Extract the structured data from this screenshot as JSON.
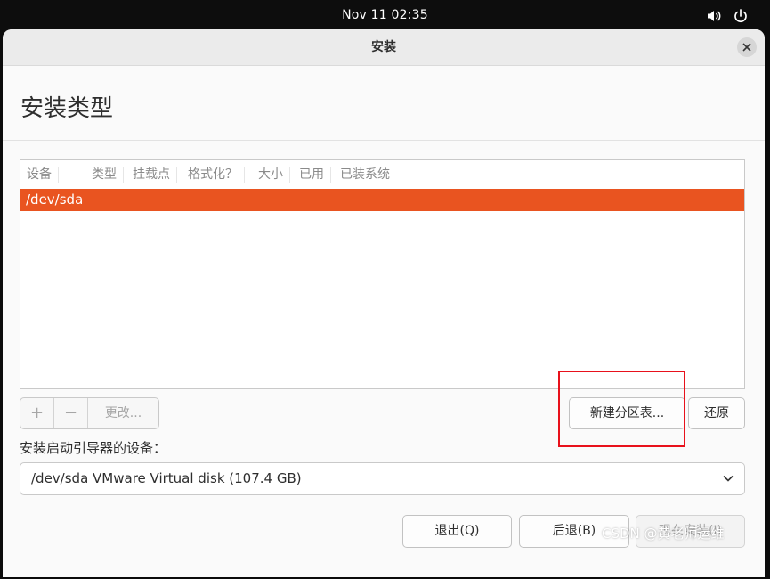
{
  "topbar": {
    "clock": "Nov 11  02:35",
    "icons": [
      "volume-icon",
      "power-icon"
    ]
  },
  "window": {
    "title": "安装",
    "close_icon": "close-icon"
  },
  "page": {
    "title": "安装类型"
  },
  "partition_table": {
    "columns": [
      "设备",
      "类型",
      "挂载点",
      "格式化？",
      "大小",
      "已用",
      "已装系统"
    ],
    "rows": [
      {
        "device": "/dev/sda",
        "selected": true
      }
    ]
  },
  "toolbar": {
    "add_label": "+",
    "remove_label": "−",
    "change_label": "更改..."
  },
  "actions": {
    "new_table_label": "新建分区表...",
    "revert_label": "还原"
  },
  "bootloader": {
    "label": "安装启动引导器的设备：",
    "selected": "/dev/sda VMware Virtual disk (107.4 GB)"
  },
  "footer": {
    "quit_label": "退出(Q)",
    "back_label": "后退(B)",
    "install_label": "现在安装(I)"
  },
  "watermark": "CSDN @黄老师运维",
  "colors": {
    "accent": "#e95420",
    "highlight_frame": "#e8111b"
  }
}
